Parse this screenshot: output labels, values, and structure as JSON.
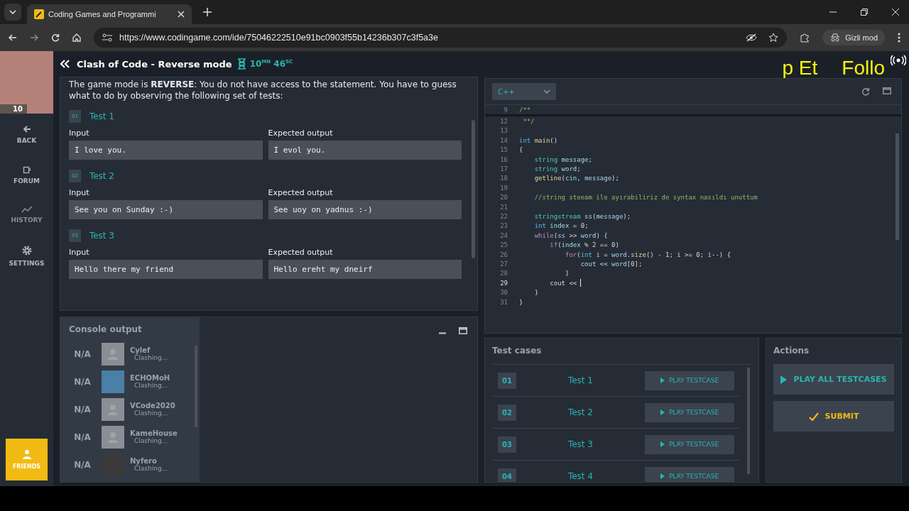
{
  "browser": {
    "tab_title": "Coding Games and Programmi",
    "url": "https://www.codingame.com/ide/75046222510e91bc0903f55b14236b307c3f5a3e",
    "profile": "Gizli mod"
  },
  "webcam": {
    "badge": "10"
  },
  "overlay": {
    "texts": [
      "p Et",
      "Follo"
    ]
  },
  "sidebar": {
    "items": [
      {
        "label": "BACK",
        "kind": "back",
        "disabled": false
      },
      {
        "label": "FORUM",
        "kind": "forum",
        "disabled": false
      },
      {
        "label": "HISTORY",
        "kind": "history",
        "disabled": true
      },
      {
        "label": "SETTINGS",
        "kind": "settings",
        "disabled": false
      }
    ],
    "friends": "FRIENDS"
  },
  "header": {
    "title": "Clash of Code - Reverse mode",
    "timer": "10$^{MN}$ 46$^{SC}$"
  },
  "statement": {
    "intro": "The game mode is **REVERSE**: You do not have access to the statement. You have to guess what to do by observing the following set of tests:",
    "tests": [
      {
        "number": "01",
        "title": "Test 1",
        "input_label": "Input",
        "input": "I love you.",
        "output_label": "Expected output",
        "output": "I evol you."
      },
      {
        "number": "02",
        "title": "Test 2",
        "input_label": "Input",
        "input": "See you on Sunday :-)",
        "output_label": "Expected output",
        "output": "See uoy on yadnus :-)"
      },
      {
        "number": "03",
        "title": "Test 3",
        "input_label": "Input",
        "input": "Hello there my friend",
        "output_label": "Expected output",
        "output": "Hello ereht my dneirf"
      }
    ]
  },
  "console": {
    "title": "Console output",
    "players": [
      {
        "score": "N/A",
        "name": "Cylef",
        "status": "Clashing...",
        "kind": "default"
      },
      {
        "score": "N/A",
        "name": "ECHOMoH",
        "status": "Clashing...",
        "kind": "picture"
      },
      {
        "score": "N/A",
        "name": "VCode2020",
        "status": "Clashing...",
        "kind": "default"
      },
      {
        "score": "N/A",
        "name": "KameHouse",
        "status": "Clashing...",
        "kind": "default"
      },
      {
        "score": "N/A",
        "name": "Nyfero",
        "status": "Clashing...",
        "kind": "photo"
      }
    ]
  },
  "editor": {
    "language": "C++",
    "sticky": {
      "number": "9",
      "tokens": [
        {
          "text": "/**",
          "kind": "comment"
        }
      ]
    },
    "lines": [
      {
        "number": "12",
        "current": false,
        "tokens": [
          {
            "text": " **/",
            "kind": "comment"
          }
        ]
      },
      {
        "number": "13",
        "current": false
      },
      {
        "number": "14",
        "current": false,
        "tokens": [
          {
            "text": "int",
            "kind": "keyword"
          },
          {
            "text": " main",
            "kind": "function"
          },
          {
            "text": "()",
            "kind": "plain"
          }
        ]
      },
      {
        "number": "15",
        "current": false,
        "tokens": [
          {
            "text": "{",
            "kind": "plain"
          }
        ]
      },
      {
        "number": "16",
        "current": false,
        "tokens": [
          {
            "text": "    string",
            "kind": "type"
          },
          {
            "text": " message",
            "kind": "variable"
          },
          {
            "text": ";",
            "kind": "plain"
          }
        ]
      },
      {
        "number": "17",
        "current": false,
        "tokens": [
          {
            "text": "    string",
            "kind": "type"
          },
          {
            "text": " word",
            "kind": "variable"
          },
          {
            "text": ";",
            "kind": "plain"
          }
        ]
      },
      {
        "number": "18",
        "current": false,
        "tokens": [
          {
            "text": "    getline",
            "kind": "function"
          },
          {
            "text": "(",
            "kind": "plain"
          },
          {
            "text": "cin",
            "kind": "variable"
          },
          {
            "text": ", ",
            "kind": "plain"
          },
          {
            "text": "message",
            "kind": "variable"
          },
          {
            "text": ");",
            "kind": "plain"
          }
        ]
      },
      {
        "number": "19",
        "current": false
      },
      {
        "number": "20",
        "current": false,
        "tokens": [
          {
            "text": "    //string steeam ile ayırabiliriz de syntax nasıldı unuttum",
            "kind": "comment"
          }
        ]
      },
      {
        "number": "21",
        "current": false
      },
      {
        "number": "22",
        "current": false,
        "tokens": [
          {
            "text": "    stringstream",
            "kind": "type"
          },
          {
            "text": " ss",
            "kind": "variable"
          },
          {
            "text": "(",
            "kind": "plain"
          },
          {
            "text": "message",
            "kind": "variable"
          },
          {
            "text": ");",
            "kind": "plain"
          }
        ]
      },
      {
        "number": "23",
        "current": false,
        "tokens": [
          {
            "text": "    int",
            "kind": "keyword"
          },
          {
            "text": " index",
            "kind": "variable"
          },
          {
            "text": " = 0;",
            "kind": "plain"
          }
        ]
      },
      {
        "number": "24",
        "current": false,
        "tokens": [
          {
            "text": "    while",
            "kind": "control"
          },
          {
            "text": "(",
            "kind": "plain"
          },
          {
            "text": "ss",
            "kind": "variable"
          },
          {
            "text": " >> ",
            "kind": "plain"
          },
          {
            "text": "word",
            "kind": "variable"
          },
          {
            "text": ") {",
            "kind": "plain"
          }
        ]
      },
      {
        "number": "25",
        "current": false,
        "tokens": [
          {
            "text": "        if",
            "kind": "control"
          },
          {
            "text": "(",
            "kind": "plain"
          },
          {
            "text": "index",
            "kind": "variable"
          },
          {
            "text": " % 2 == 0)",
            "kind": "plain"
          }
        ]
      },
      {
        "number": "26",
        "current": false,
        "tokens": [
          {
            "text": "            for",
            "kind": "control"
          },
          {
            "text": "(",
            "kind": "plain"
          },
          {
            "text": "int",
            "kind": "keyword"
          },
          {
            "text": " i",
            "kind": "variable"
          },
          {
            "text": " = ",
            "kind": "plain"
          },
          {
            "text": "word",
            "kind": "variable"
          },
          {
            "text": ".",
            "kind": "plain"
          },
          {
            "text": "size",
            "kind": "function"
          },
          {
            "text": "() - 1; ",
            "kind": "plain"
          },
          {
            "text": "i",
            "kind": "variable"
          },
          {
            "text": " >= 0; ",
            "kind": "plain"
          },
          {
            "text": "i",
            "kind": "variable"
          },
          {
            "text": "--) {",
            "kind": "plain"
          }
        ]
      },
      {
        "number": "27",
        "current": false,
        "tokens": [
          {
            "text": "                cout",
            "kind": "variable"
          },
          {
            "text": " << ",
            "kind": "plain"
          },
          {
            "text": "word",
            "kind": "variable"
          },
          {
            "text": "[0];",
            "kind": "plain"
          }
        ]
      },
      {
        "number": "28",
        "current": false,
        "tokens": [
          {
            "text": "            }",
            "kind": "plain"
          }
        ]
      },
      {
        "number": "29",
        "current": true,
        "tokens": [
          {
            "text": "        cout <<",
            "kind": "plain"
          }
        ]
      },
      {
        "number": "30",
        "current": false,
        "tokens": [
          {
            "text": "    }",
            "kind": "plain"
          }
        ]
      },
      {
        "number": "31",
        "current": false,
        "tokens": [
          {
            "text": "}",
            "kind": "plain"
          }
        ]
      }
    ]
  },
  "test_cases": {
    "title": "Test cases",
    "items": [
      {
        "number": "01",
        "name": "Test 1",
        "button": "PLAY TESTCASE"
      },
      {
        "number": "02",
        "name": "Test 2",
        "button": "PLAY TESTCASE"
      },
      {
        "number": "03",
        "name": "Test 3",
        "button": "PLAY TESTCASE"
      },
      {
        "number": "04",
        "name": "Test 4",
        "button": "PLAY TESTCASE"
      }
    ]
  },
  "actions": {
    "title": "Actions",
    "buttons": [
      {
        "label": "PLAY ALL TESTCASES",
        "kind": "play"
      },
      {
        "label": "SUBMIT",
        "kind": "submit"
      }
    ]
  }
}
